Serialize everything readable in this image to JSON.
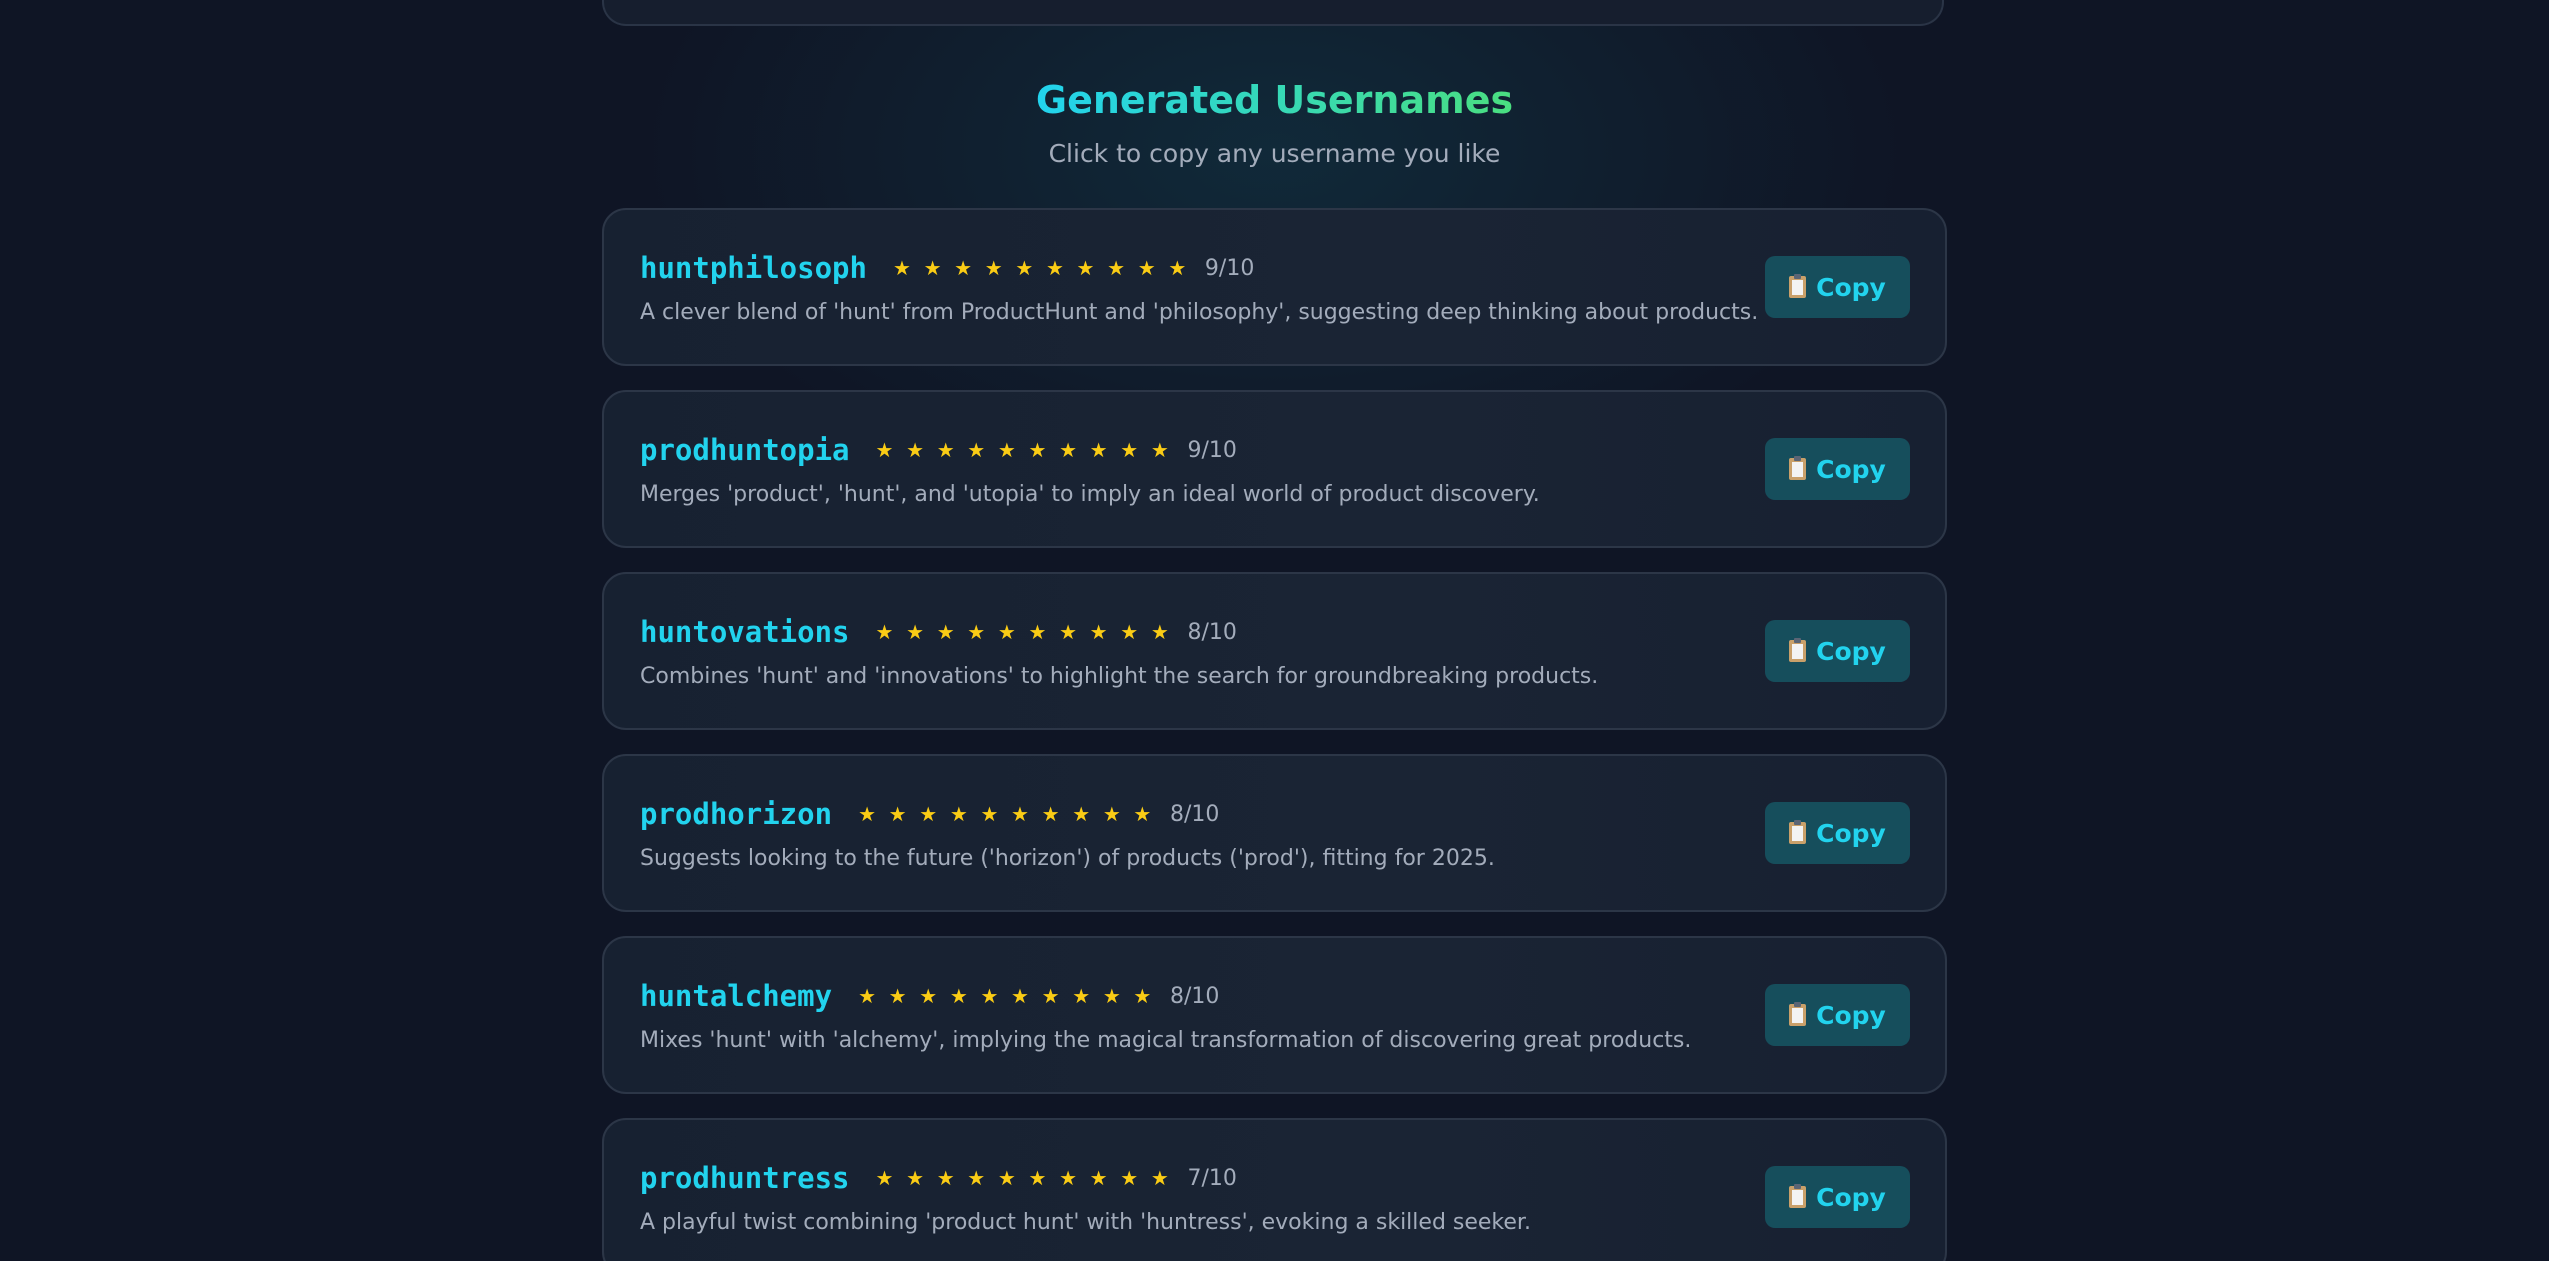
{
  "header": {
    "title": "Generated Usernames",
    "subtitle": "Click to copy any username you like"
  },
  "colors": {
    "background": "#0f1525",
    "accent_cyan": "#22d3ee",
    "accent_green": "#4ade80",
    "star": "#facc15",
    "button_bg": "#164e5c"
  },
  "copy_icon": "clipboard-icon",
  "star_icon": "star-icon",
  "usernames": [
    {
      "name": "huntphilosoph",
      "rating": 9,
      "max": 10,
      "score_label": "9/10",
      "description": "A clever blend of 'hunt' from ProductHunt and 'philosophy', suggesting deep thinking about products.",
      "copy_label": "Copy"
    },
    {
      "name": "prodhuntopia",
      "rating": 9,
      "max": 10,
      "score_label": "9/10",
      "description": "Merges 'product', 'hunt', and 'utopia' to imply an ideal world of product discovery.",
      "copy_label": "Copy"
    },
    {
      "name": "huntovations",
      "rating": 8,
      "max": 10,
      "score_label": "8/10",
      "description": "Combines 'hunt' and 'innovations' to highlight the search for groundbreaking products.",
      "copy_label": "Copy"
    },
    {
      "name": "prodhorizon",
      "rating": 8,
      "max": 10,
      "score_label": "8/10",
      "description": "Suggests looking to the future ('horizon') of products ('prod'), fitting for 2025.",
      "copy_label": "Copy"
    },
    {
      "name": "huntalchemy",
      "rating": 8,
      "max": 10,
      "score_label": "8/10",
      "description": "Mixes 'hunt' with 'alchemy', implying the magical transformation of discovering great products.",
      "copy_label": "Copy"
    },
    {
      "name": "prodhuntress",
      "rating": 7,
      "max": 10,
      "score_label": "7/10",
      "description": "A playful twist combining 'product hunt' with 'huntress', evoking a skilled seeker.",
      "copy_label": "Copy"
    }
  ]
}
